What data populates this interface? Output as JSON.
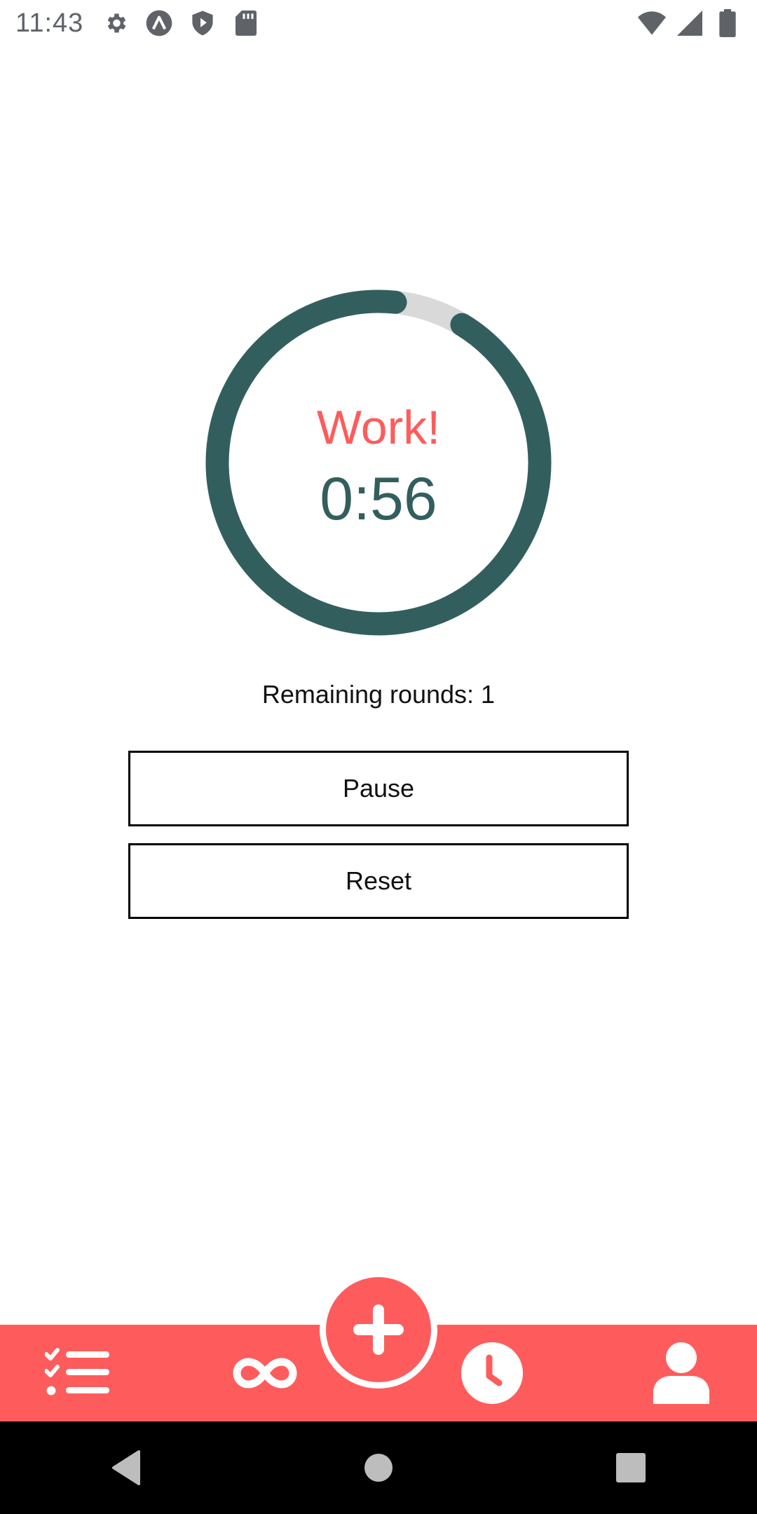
{
  "colors": {
    "accent": "#fe5c5c",
    "primary": "#325f5e",
    "track": "#d9d9d9",
    "status_icon": "#5f6368"
  },
  "status_bar": {
    "time": "11:43",
    "icons": [
      "gear-icon",
      "app-logo-icon",
      "shield-play-icon",
      "sd-card-icon",
      "wifi-icon",
      "signal-icon",
      "battery-icon"
    ]
  },
  "timer": {
    "phase": "Work!",
    "time": "0:56",
    "progress": 0.93
  },
  "rounds": {
    "text": "Remaining rounds: 1"
  },
  "controls": {
    "pause_label": "Pause",
    "reset_label": "Reset"
  },
  "tab_bar": {
    "items": [
      "checklist-icon",
      "infinity-icon",
      "add-icon",
      "clock-icon",
      "person-icon"
    ]
  },
  "nav_bar": {
    "items": [
      "back-icon",
      "home-icon",
      "recents-icon"
    ]
  }
}
